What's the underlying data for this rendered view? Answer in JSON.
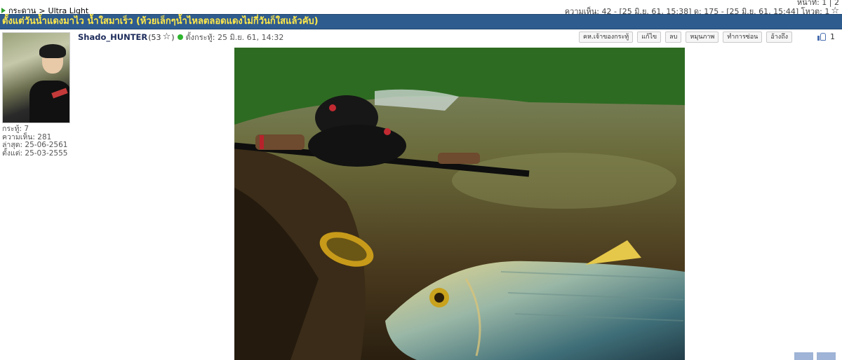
{
  "top": {
    "pager_label": "หน้าที่: 1 | 2",
    "breadcrumb_home": "กระดาน",
    "breadcrumb_sep": ">",
    "breadcrumb_current": "Ultra Light",
    "stats": "ความเห็น: 42 - [25 มิ.ย. 61, 15:38] ดู: 175 - [25 มิ.ย. 61, 15:44] โหวต: 1"
  },
  "thread": {
    "title": "ตั้งแต่วันน้ำแดงมาไว น้ำใสมาเร็ว (ห้วยเล็กๆน้ำไหลตลอดแดงไม่กี่วันก็ใสแล้วคับ)"
  },
  "post": {
    "username": "Shado_HUNTER",
    "reputation": "(53",
    "posted_label": "ตั้งกระทู้: 25 มิ.ย. 61, 14:32",
    "like_count": "1",
    "user_stats": {
      "threads": "กระทู้: 7",
      "comments": "ความเห็น: 281",
      "last": "ล่าสุด: 25-06-2561",
      "since": "ตั้งแต่: 25-03-2555"
    },
    "actions": [
      "คห.เจ้าของกระทู้",
      "แก้ไข",
      "ลบ",
      "หมุนภาพ",
      "ทำการซ่อน",
      "อ้างถึง"
    ]
  },
  "colors": {
    "title_bar": "#2f5c8f",
    "title_text": "#ffe84a",
    "online": "#2db52d"
  },
  "icons": [
    "play-arrow-icon",
    "star-icon",
    "online-dot-icon",
    "thumbs-up-icon"
  ]
}
